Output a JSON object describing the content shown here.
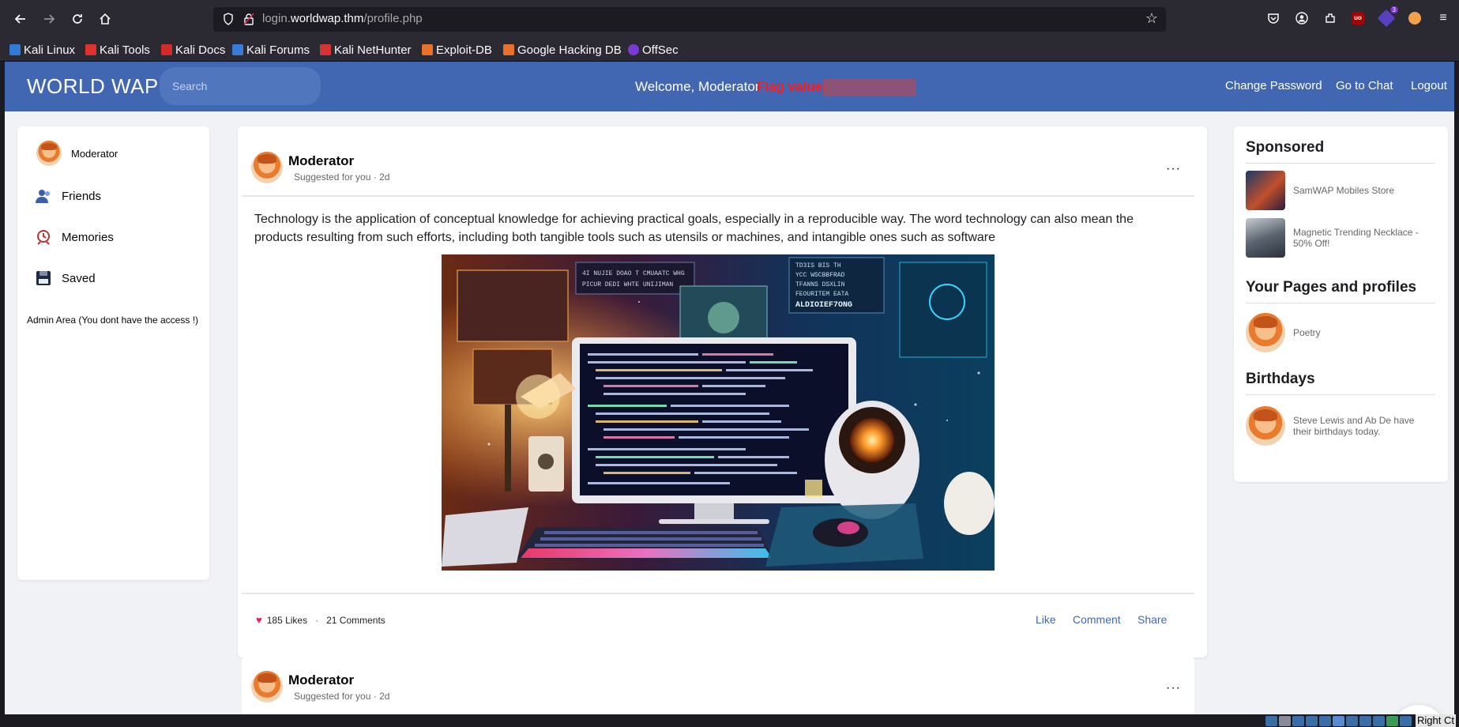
{
  "browser": {
    "url_host_prefix": "login.",
    "url_host": "worldwap.thm",
    "url_path": "/profile.php",
    "extension_badge": "3",
    "bookmarks": [
      {
        "label": "Kali Linux",
        "color": "#2f7bd6"
      },
      {
        "label": "Kali Tools",
        "color": "#e03131"
      },
      {
        "label": "Kali Docs",
        "color": "#d42a2a"
      },
      {
        "label": "Kali Forums",
        "color": "#3a7bd5"
      },
      {
        "label": "Kali NetHunter",
        "color": "#d63333"
      },
      {
        "label": "Exploit-DB",
        "color": "#e8722b"
      },
      {
        "label": "Google Hacking DB",
        "color": "#e8722b"
      },
      {
        "label": "OffSec",
        "color": "#7a3ad5"
      }
    ]
  },
  "header": {
    "brand": "WORLD WAP",
    "search_placeholder": "Search",
    "welcome": "Welcome, Moderator",
    "flag_label": "Flag value:",
    "links": [
      "Change Password",
      "Go to Chat",
      "Logout"
    ],
    "bg_color": "#4267b2"
  },
  "left_sidebar": {
    "profile_name": "Moderator",
    "items": [
      "Friends",
      "Memories",
      "Saved"
    ],
    "admin_text": "Admin Area (You dont have the access !)"
  },
  "posts": [
    {
      "author": "Moderator",
      "meta": "Suggested for you · 2d",
      "text": "Technology is the application of conceptual knowledge for achieving practical goals, especially in a reproducible way. The word technology can also mean the products resulting from such efforts, including both tangible tools such as utensils or machines, and intangible ones such as software",
      "likes": "185 Likes",
      "separator": "·",
      "comments": "21 Comments",
      "actions": [
        "Like",
        "Comment",
        "Share"
      ]
    },
    {
      "author": "Moderator",
      "meta": "Suggested for you · 2d"
    }
  ],
  "image_text": {
    "line1": "TD3IS BIS TH",
    "line2": "YCC WSCBBFRAD",
    "line3": "TFANNS DSXLIN",
    "line4": "FEOURITEM EATA",
    "line5": "ALDIOIEF7ONG",
    "left1": "4I NUJIE DOAO T CMUAATC WHG",
    "left2": "PICUR DEDI WHTE UNIJIMAN"
  },
  "right_sidebar": {
    "sponsored_title": "Sponsored",
    "sponsored": [
      "SamWAP Mobiles Store",
      "Magnetic Trending Necklace - 50% Off!"
    ],
    "pages_title": "Your Pages and profiles",
    "pages": [
      "Poetry"
    ],
    "birthdays_title": "Birthdays",
    "birthday_text": "Steve Lewis and Ab De have their birthdays today."
  },
  "status_text": "Right Ct"
}
